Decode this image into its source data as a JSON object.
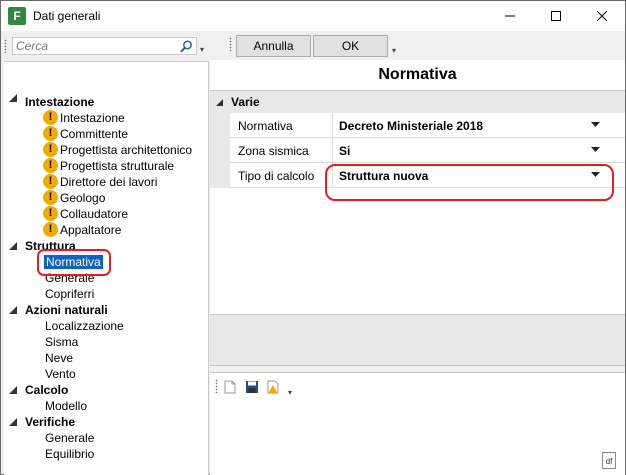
{
  "window": {
    "title": "Dati generali",
    "app_icon": "F"
  },
  "search": {
    "placeholder": "Cerca"
  },
  "tree": {
    "groups": [
      {
        "label": "Intestazione",
        "items": [
          {
            "label": "Intestazione",
            "warning": true
          },
          {
            "label": "Committente",
            "warning": true
          },
          {
            "label": "Progettista architettonico",
            "warning": true
          },
          {
            "label": "Progettista strutturale",
            "warning": true
          },
          {
            "label": "Direttore dei lavori",
            "warning": true
          },
          {
            "label": "Geologo",
            "warning": true
          },
          {
            "label": "Collaudatore",
            "warning": true
          },
          {
            "label": "Appaltatore",
            "warning": true
          }
        ]
      },
      {
        "label": "Struttura",
        "items": [
          {
            "label": "Normativa",
            "selected": true
          },
          {
            "label": "Generale"
          },
          {
            "label": "Copriferri"
          }
        ]
      },
      {
        "label": "Azioni naturali",
        "items": [
          {
            "label": "Localizzazione"
          },
          {
            "label": "Sisma"
          },
          {
            "label": "Neve"
          },
          {
            "label": "Vento"
          }
        ]
      },
      {
        "label": "Calcolo",
        "items": [
          {
            "label": "Modello"
          }
        ]
      },
      {
        "label": "Verifiche",
        "items": [
          {
            "label": "Generale"
          },
          {
            "label": "Equilibrio"
          }
        ]
      }
    ]
  },
  "toolbar": {
    "cancel_label": "Annulla",
    "ok_label": "OK"
  },
  "panel": {
    "title": "Normativa",
    "category": "Varie",
    "properties": [
      {
        "name": "Normativa",
        "value": "Decreto Ministeriale 2018"
      },
      {
        "name": "Zona sismica",
        "value": "Si"
      },
      {
        "name": "Tipo di calcolo",
        "value": "Struttura nuova"
      }
    ]
  },
  "status": {
    "icon_label": "df"
  },
  "colors": {
    "selection": "#0f62c4",
    "highlight": "#e02020",
    "warning": "#f2a900",
    "app_icon": "#2f8a3c"
  }
}
